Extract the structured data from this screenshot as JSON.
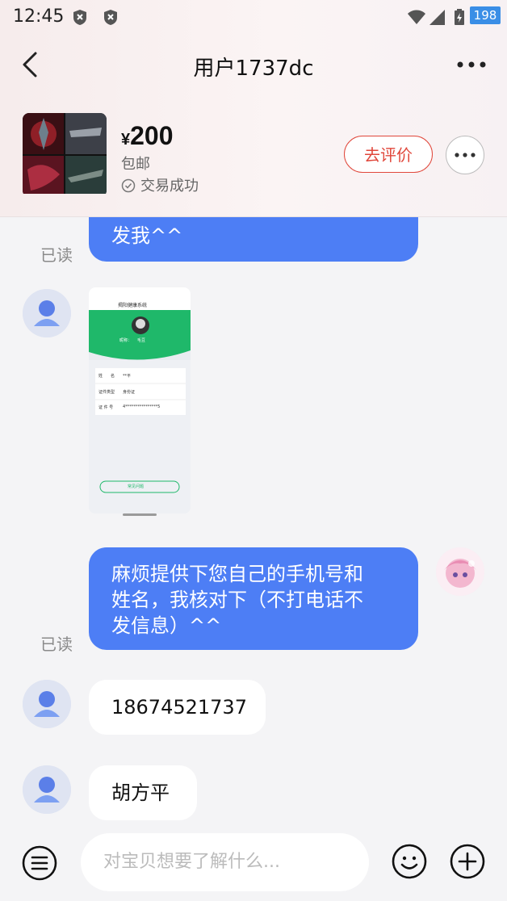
{
  "status_bar": {
    "time": "12:45",
    "battery": "198"
  },
  "header": {
    "title": "用户1737dc"
  },
  "product": {
    "currency": "¥",
    "price": "200",
    "shipping": "包邮",
    "trade_status": "交易成功",
    "review_button": "去评价"
  },
  "messages": {
    "m1_partial": "发我^^",
    "m1_read": "已读",
    "m3_line1": "麻烦提供下您自己的手机号和",
    "m3_line2": "姓名，我核对下（不打电话不",
    "m3_line3": "发信息）^^",
    "m3_read": "已读",
    "m4": "18674521737",
    "m5": "胡方平"
  },
  "image_message": {
    "app_title": "揭阳健康系统",
    "label_nickname": "昵称：",
    "nickname_value": "毛豆",
    "field_name_label": "姓　　名",
    "field_name_value": "**平",
    "field_idtype_label": "证件类型",
    "field_idtype_value": "身份证",
    "field_idnum_label": "证 件 号",
    "field_idnum_value": "4****************5",
    "button_text": "常见问题"
  },
  "composer": {
    "placeholder": "对宝贝想要了解什么..."
  },
  "colors": {
    "accent_blue": "#4d7ef5",
    "review_red": "#e0473b",
    "badge_blue": "#3a8ee6"
  }
}
